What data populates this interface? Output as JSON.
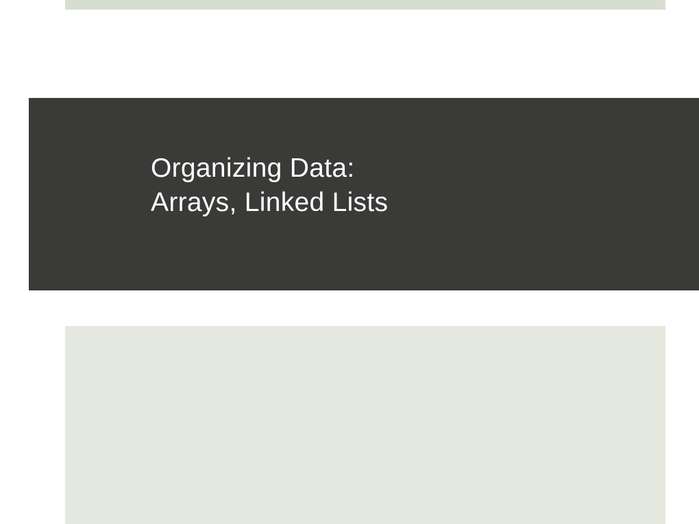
{
  "slide": {
    "title_line1": "Organizing Data:",
    "title_line2": "Arrays, Linked Lists"
  },
  "colors": {
    "accent_light": "#d8ddd1",
    "panel_dark": "#3a3a38",
    "panel_light": "#e4e8de",
    "text": "#ffffff"
  }
}
